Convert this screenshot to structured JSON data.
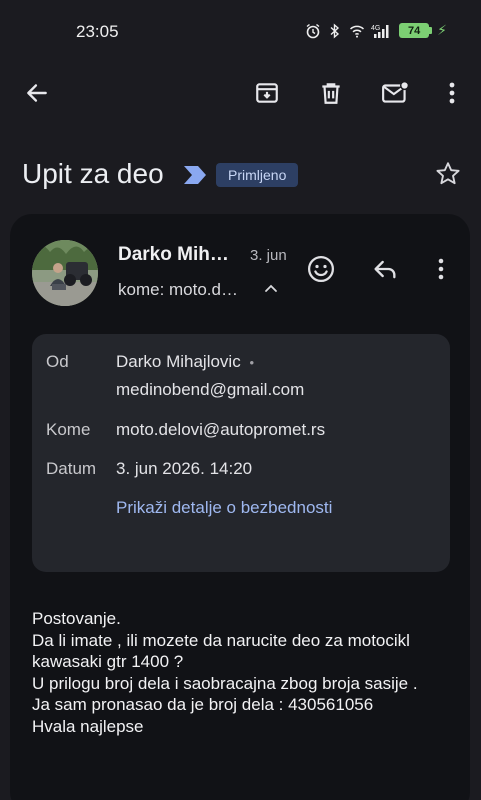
{
  "status": {
    "time": "23:05",
    "battery": "74",
    "icons": [
      "alarm-icon",
      "bluetooth-icon",
      "wifi-icon",
      "4g-icon",
      "signal-icon",
      "battery-icon",
      "charging-icon"
    ]
  },
  "appbar": {
    "icons": [
      "back-arrow-icon",
      "archive-icon",
      "delete-icon",
      "mark-unread-icon",
      "more-vert-icon"
    ]
  },
  "email": {
    "subject": "Upit za deo",
    "label": "Primljeno",
    "sender_name": "Darko Mih…",
    "date_short": "3. jun",
    "to_short": "kome: moto.d…"
  },
  "details": {
    "from_label": "Od",
    "from_name": "Darko Mihajlovic",
    "from_sep": "•",
    "from_email": "medinobend@gmail.com",
    "to_label": "Kome",
    "to_value": "moto.delovi@autopromet.rs",
    "date_label": "Datum",
    "date_value": "3. jun 2026. 14:20",
    "security_link": "Prikaži detalje o bezbednosti"
  },
  "body": {
    "lines": [
      "Postovanje.",
      "Da li imate , ili mozete da narucite deo za motocikl",
      "kawasaki gtr 1400 ?",
      "U prilogu broj dela i saobracajna zbog broja sasije .",
      "Ja sam pronasao da je broj dela : 430561056",
      "Hvala najlepse"
    ]
  },
  "colors": {
    "background": "#1b1b20",
    "card": "#111216",
    "details_panel": "#24262c",
    "badge_bg": "#2d3f63",
    "link": "#9fb8f0",
    "battery": "#7ccf73"
  }
}
